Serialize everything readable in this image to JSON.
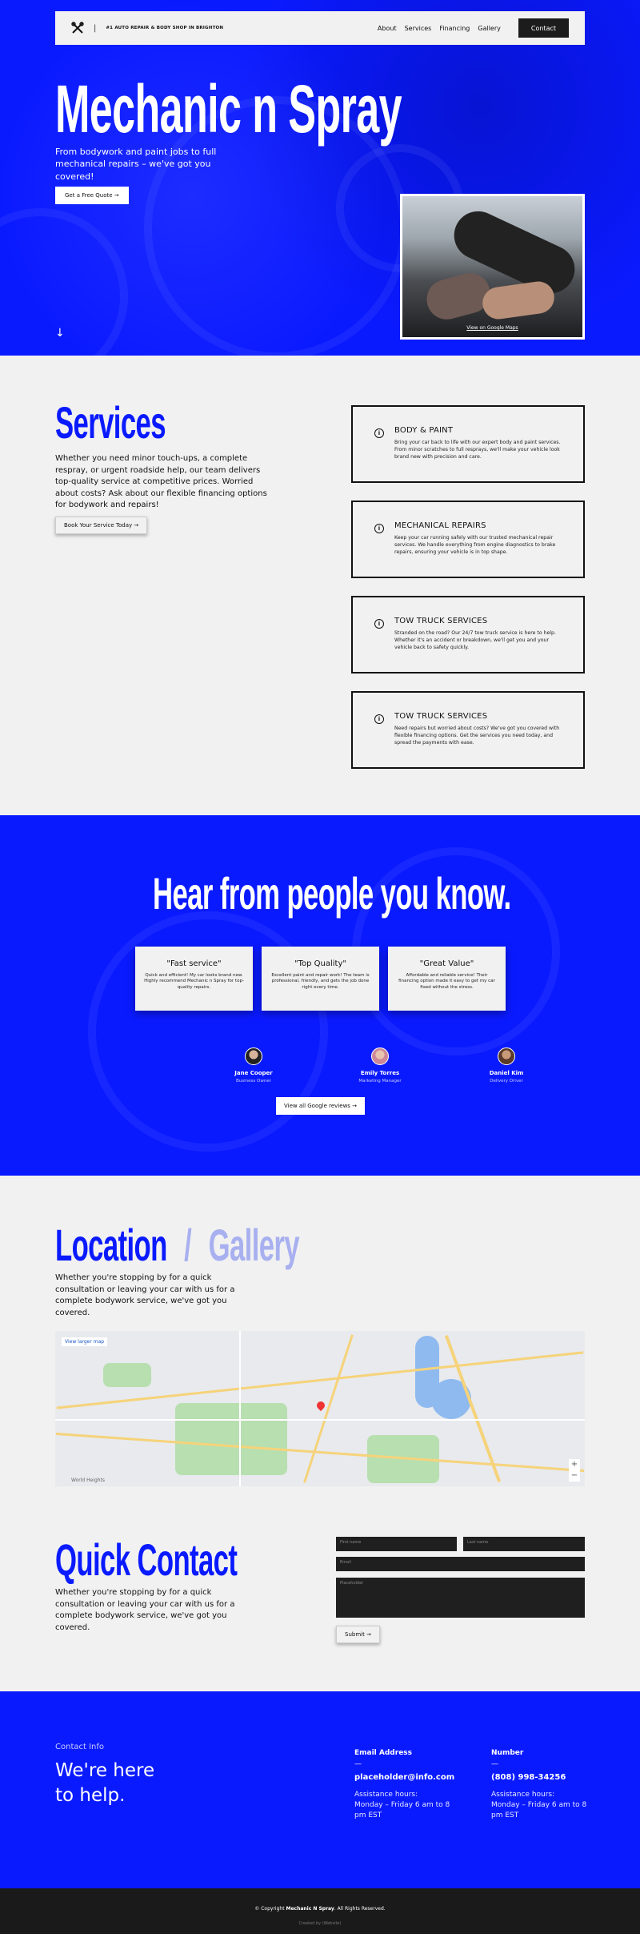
{
  "nav": {
    "tagline": "#1 AUTO REPAIR & BODY SHOP IN BRIGHTON",
    "divider": "|",
    "links": [
      "About",
      "Services",
      "Financing",
      "Gallery"
    ],
    "contact": "Contact"
  },
  "hero": {
    "title": "Mechanic n Spray",
    "subtitle": "From bodywork and paint jobs to full mechanical repairs – we've got you covered!",
    "cta": "Get a Free Quote →",
    "photo_link": "View on Google Maps",
    "arrow": "↓"
  },
  "services": {
    "title": "Services",
    "text": "Whether you need minor touch-ups, a complete respray, or urgent roadside help, our team delivers top-quality service at competitive prices. Worried about costs? Ask about our flexible financing options for bodywork and repairs!",
    "cta": "Book Your Service Today →",
    "cards": [
      {
        "title": "BODY & PAINT",
        "text": "Bring your car back to life with our expert body and paint services. From minor scratches to full resprays, we'll make your vehicle look brand new with precision and care."
      },
      {
        "title": "MECHANICAL REPAIRS",
        "text": "Keep your car running safely with our trusted mechanical repair services. We handle everything from engine diagnostics to brake repairs, ensuring your vehicle is in top shape."
      },
      {
        "title": "TOW TRUCK SERVICES",
        "text": "Stranded on the road? Our 24/7 tow truck service is here to help. Whether it's an accident or breakdown, we'll get you and your vehicle back to safety quickly."
      },
      {
        "title": "TOW TRUCK SERVICES",
        "text": "Need repairs but worried about costs? We've got you covered with flexible financing options. Get the services you need today, and spread the payments with ease."
      }
    ]
  },
  "testimonials": {
    "title": "Hear from people you know.",
    "cards": [
      {
        "title": "\"Fast service\"",
        "text": "Quick and efficient! My car looks brand new. Highly recommend Mechanic n Spray for top-quality repairs."
      },
      {
        "title": "\"Top Quality\"",
        "text": "Excellent paint and repair work! The team is professional, friendly, and gets the job done right every time."
      },
      {
        "title": "\"Great Value\"",
        "text": "Affordable and reliable service! Their financing option made it easy to get my car fixed without the stress."
      }
    ],
    "people": [
      {
        "name": "Jane Cooper",
        "role": "Business Owner"
      },
      {
        "name": "Emily Torres",
        "role": "Marketing Manager"
      },
      {
        "name": "Daniel Kim",
        "role": "Delivery Driver"
      }
    ],
    "cta": "View all Google reviews →"
  },
  "location": {
    "title_a": "Location",
    "title_sep": "/",
    "title_b": "Gallery",
    "text": "Whether you're stopping by for a quick consultation or leaving your car with us for a complete bodywork service, we've got you covered.",
    "map_link": "View larger map",
    "zoom_in": "+",
    "zoom_out": "−",
    "map_brand": "World Heights"
  },
  "quick_contact": {
    "title": "Quick Contact",
    "text": "Whether you're stopping by for a quick consultation or leaving your car with us for a complete bodywork service, we've got you covered.",
    "first_name": "First name",
    "last_name": "Last name",
    "email": "Email",
    "message": "Placeholder",
    "submit": "Submit →"
  },
  "footer": {
    "label": "Contact Info",
    "heading_line1": "We're here",
    "heading_line2": "to help.",
    "email_title": "Email Address",
    "email": "placeholder@info.com",
    "phone_title": "Number",
    "phone": "(808) 998-34256",
    "dash": "—",
    "hours_label": "Assistance hours:",
    "hours": "Monday – Friday 6 am to 8 pm EST",
    "copyright_prefix": "© Copyright",
    "copyright_brand": "Mechanic N Spray",
    "copyright_suffix": ". All Rights Reserved.",
    "credit": "Created by (Website)"
  },
  "colors": {
    "brand_blue": "#0a1aff",
    "dark": "#1c1c1c",
    "light": "#f1f1f1"
  }
}
